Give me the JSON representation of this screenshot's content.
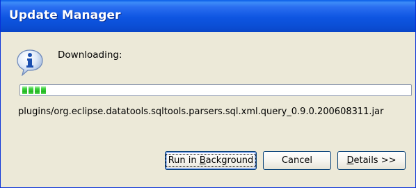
{
  "window": {
    "title": "Update Manager"
  },
  "status": {
    "icon": "info-icon",
    "label": "Downloading:"
  },
  "progress": {
    "value_fraction": 0.07,
    "segments": 4,
    "color": "#22b622"
  },
  "file": {
    "name": "plugins/org.eclipse.datatools.sqltools.parsers.sql.xml.query_0.9.0.200608311.jar"
  },
  "buttons": {
    "run_in_background": {
      "prefix": "Run in ",
      "mnemonic": "B",
      "suffix": "ackground"
    },
    "cancel": {
      "label": "Cancel"
    },
    "details": {
      "mnemonic": "D",
      "suffix": "etails >>"
    }
  },
  "colors": {
    "titlebar": "#0a4fd6",
    "dialog_bg": "#ece9d8",
    "button_border": "#003c74"
  }
}
